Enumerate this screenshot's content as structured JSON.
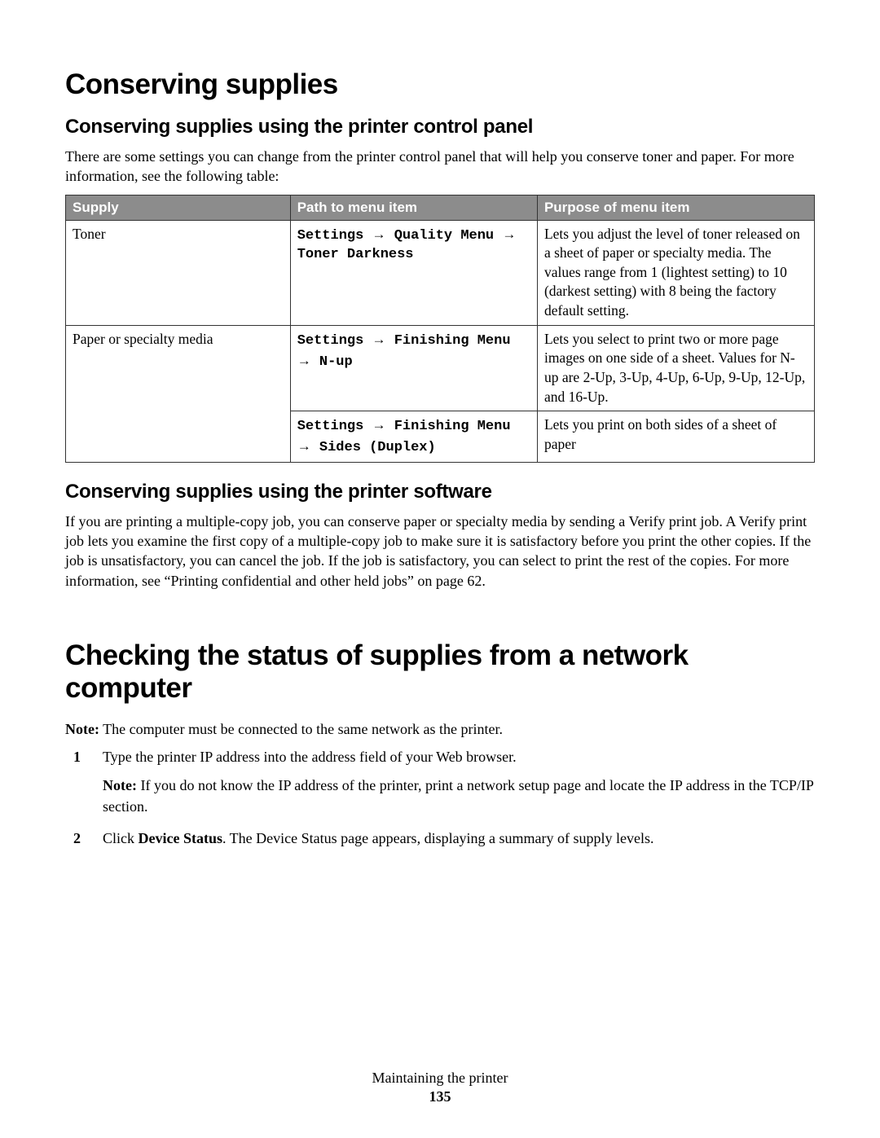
{
  "section1": {
    "heading": "Conserving supplies",
    "sub1": {
      "heading": "Conserving supplies using the printer control panel",
      "intro": "There are some settings you can change from the printer control panel that will help you conserve toner and paper. For more information, see the following table:",
      "table": {
        "headers": {
          "c1": "Supply",
          "c2": "Path to menu item",
          "c3": "Purpose of menu item"
        },
        "rows": {
          "r1": {
            "supply": "Toner",
            "path_prefix1": "Settings ",
            "path_mid1": " Quality Menu ",
            "path_end1": " Toner Darkness",
            "purpose": "Lets you adjust the level of toner released on a sheet of paper or specialty media. The values range from 1 (lightest setting) to 10 (darkest setting) with 8 being the factory default setting."
          },
          "r2": {
            "supply": "Paper or specialty media",
            "path_prefix1": "Settings ",
            "path_mid1": " Finishing Menu ",
            "path_end1": " N-up",
            "purpose1": "Lets you select to print two or more page images on one side of a sheet. Values for N-up are 2-Up, 3-Up, 4-Up, 6-Up, 9-Up, 12-Up, and 16-Up.",
            "path_prefix2": "Settings ",
            "path_mid2": " Finishing Menu ",
            "path_end2": " Sides (Duplex)",
            "purpose2": "Lets you print on both sides of a sheet of paper"
          }
        }
      }
    },
    "sub2": {
      "heading": "Conserving supplies using the printer software",
      "body": "If you are printing a multiple-copy job, you can conserve paper or specialty media by sending a Verify print job. A Verify print job lets you examine the first copy of a multiple-copy job to make sure it is satisfactory before you print the other copies. If the job is unsatisfactory, you can cancel the job. If the job is satisfactory, you can select to print the rest of the copies. For more information, see “Printing confidential and other held jobs” on page 62."
    }
  },
  "section2": {
    "heading": "Checking the status of supplies from a network computer",
    "note_label": "Note:",
    "note_text": " The computer must be connected to the same network as the printer.",
    "steps": {
      "s1": {
        "num": "1",
        "text": "Type the printer IP address into the address field of your Web browser.",
        "sub_note_label": "Note:",
        "sub_note_text": " If you do not know the IP address of the printer, print a network setup page and locate the IP address in the TCP/IP section."
      },
      "s2": {
        "num": "2",
        "pre": "Click ",
        "bold": "Device Status",
        "post": ". The Device Status page appears, displaying a summary of supply levels."
      }
    }
  },
  "footer": {
    "title": "Maintaining the printer",
    "page": "135"
  },
  "arrow": "→"
}
